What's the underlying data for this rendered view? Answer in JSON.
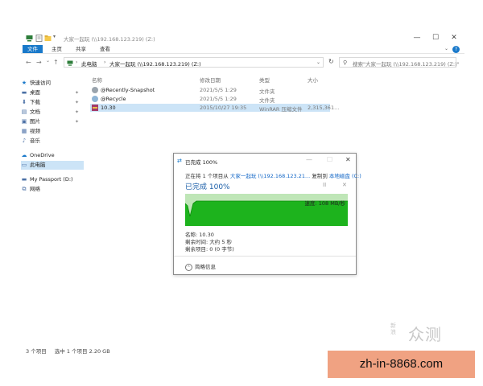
{
  "window": {
    "title": "大家一起玩 (\\\\192.168.123.219) (Z:)",
    "controls": {
      "minimize": "—",
      "maximize": "☐",
      "close": "✕"
    }
  },
  "ribbon": {
    "tabs": [
      "文件",
      "主页",
      "共享",
      "查看"
    ],
    "active_tab": 0,
    "help": "?",
    "accent_color": "#1979ca"
  },
  "address": {
    "back": "←",
    "forward": "→",
    "recent": "⌄",
    "up": "↑",
    "crumbs": [
      "此电脑",
      "大家一起玩 (\\\\192.168.123.219) (Z:)"
    ],
    "refresh": "↻",
    "search_placeholder": "搜索\"大家一起玩 (\\\\192.168.123.219) (Z:)\""
  },
  "sidebar": {
    "items": [
      {
        "label": "快速访问",
        "icon": "star-icon",
        "glyph": "★",
        "pinned": false
      },
      {
        "label": "桌面",
        "icon": "desktop-icon",
        "glyph": "▬",
        "pinned": true
      },
      {
        "label": "下载",
        "icon": "download-icon",
        "glyph": "⬇",
        "pinned": true
      },
      {
        "label": "文档",
        "icon": "document-icon",
        "glyph": "▤",
        "pinned": true
      },
      {
        "label": "图片",
        "icon": "picture-icon",
        "glyph": "▣",
        "pinned": true
      },
      {
        "label": "视频",
        "icon": "video-icon",
        "glyph": "▦",
        "pinned": false
      },
      {
        "label": "音乐",
        "icon": "music-icon",
        "glyph": "♪",
        "pinned": false
      },
      {
        "label": "OneDrive",
        "icon": "cloud-icon",
        "glyph": "☁",
        "pinned": false
      },
      {
        "label": "此电脑",
        "icon": "computer-icon",
        "glyph": "▭",
        "pinned": false,
        "selected": true
      },
      {
        "label": "My Passport (D:)",
        "icon": "drive-icon",
        "glyph": "▬",
        "pinned": false
      },
      {
        "label": "网络",
        "icon": "network-icon",
        "glyph": "⧉",
        "pinned": false
      }
    ]
  },
  "list": {
    "columns": [
      "名称",
      "修改日期",
      "类型",
      "大小"
    ],
    "rows": [
      {
        "name": "@Recently-Snapshot",
        "date": "2021/5/5 1:29",
        "type": "文件夹",
        "size": "",
        "icon": "gear-folder-icon"
      },
      {
        "name": "@Recycle",
        "date": "2021/5/5 1:29",
        "type": "文件夹",
        "size": "",
        "icon": "recycle-folder-icon"
      },
      {
        "name": "10.30",
        "date": "2015/10/27 19:35",
        "type": "WinRAR 压缩文件",
        "size": "2,315,361...",
        "icon": "archive-icon",
        "selected": true
      }
    ]
  },
  "status": {
    "count": "3 个项目",
    "selection": "选中 1 个项目  2.20 GB"
  },
  "dialog": {
    "title": "已完成 100%",
    "line_prefix": "正在将 1 个项目从",
    "source": "大家一起玩 (\\\\192.168.123.21...",
    "line_middle": "复制到",
    "destination": "本地磁盘 (C:)",
    "heading": "已完成 100%",
    "pause": "II",
    "cancel": "✕",
    "speed": "速度: 108 MB/秒",
    "name_line": "名称: 10.30",
    "time_line": "剩余时间: 大约 5 秒",
    "items_line": "剩余项目: 0 (0 字节)",
    "fewer_details": "简略信息",
    "progress_fraction": 1.0,
    "fill_color": "#1db31d",
    "bg_color": "#bfe6b7"
  },
  "watermark": {
    "main": "众测",
    "small1": "新",
    "small2": "浪"
  },
  "banner": {
    "text": "zh-in-8868.com"
  }
}
